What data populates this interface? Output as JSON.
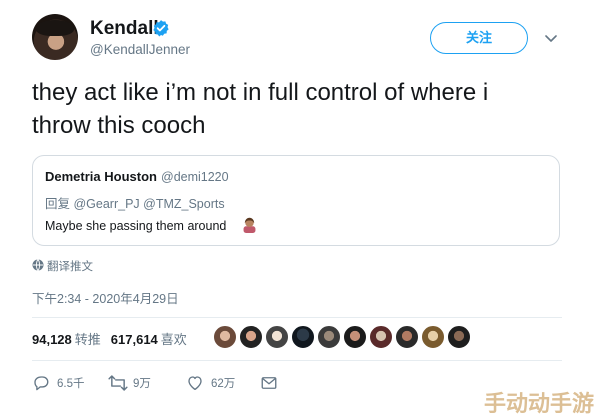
{
  "author": {
    "name": "Kendall",
    "handle": "@KendallJenner"
  },
  "follow_label": "关注",
  "tweet": {
    "text_line1": "they act like i’m not in full control of where i",
    "text_line2": "throw this cooch"
  },
  "quote": {
    "name": "Demetria Houston",
    "handle": "@demi1220",
    "reply_to": "回复 @Gearr_PJ @TMZ_Sports",
    "text": "Maybe she passing them around"
  },
  "translate_label": "翻译推文",
  "timestamp": "下午2:34 - 2020年4月29日",
  "stats": {
    "retweets": "94,128",
    "retweets_label": "转推",
    "likes": "617,614",
    "likes_label": "喜欢"
  },
  "actions": {
    "replies": "6.5千",
    "retweets": "9万",
    "likes": "62万"
  },
  "watermark": "手动动手游",
  "colors": {
    "accent": "#1da1f2",
    "muted": "#657786",
    "divider": "#e6ecf0"
  }
}
